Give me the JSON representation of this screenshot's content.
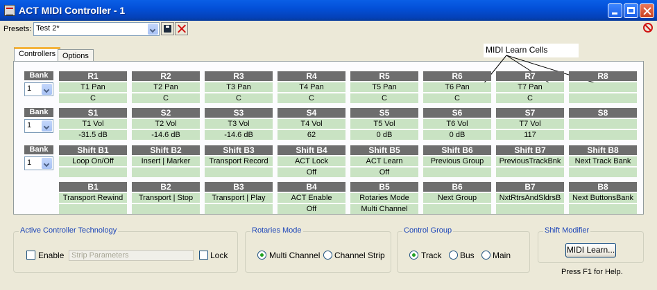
{
  "window": {
    "title": "ACT MIDI Controller - 1"
  },
  "presets": {
    "label": "Presets:",
    "value": "Test 2*"
  },
  "tabs": [
    {
      "label": "Controllers"
    },
    {
      "label": "Options"
    }
  ],
  "annotation": "MIDI Learn Cells",
  "bank_label": "Bank",
  "rows": [
    {
      "bank": "1",
      "cells": [
        {
          "h": "R1",
          "a": "T1 Pan",
          "b": "C"
        },
        {
          "h": "R2",
          "a": "T2 Pan",
          "b": "C"
        },
        {
          "h": "R3",
          "a": "T3 Pan",
          "b": "C"
        },
        {
          "h": "R4",
          "a": "T4 Pan",
          "b": "C"
        },
        {
          "h": "R5",
          "a": "T5 Pan",
          "b": "C"
        },
        {
          "h": "R6",
          "a": "T6 Pan",
          "b": "C"
        },
        {
          "h": "R7",
          "a": "T7 Pan",
          "b": "C"
        },
        {
          "h": "R8",
          "a": "",
          "b": ""
        }
      ]
    },
    {
      "bank": "1",
      "cells": [
        {
          "h": "S1",
          "a": "T1 Vol",
          "b": "-31.5  dB"
        },
        {
          "h": "S2",
          "a": "T2 Vol",
          "b": "-14.6  dB"
        },
        {
          "h": "S3",
          "a": "T3 Vol",
          "b": "-14.6  dB"
        },
        {
          "h": "S4",
          "a": "T4 Vol",
          "b": "62"
        },
        {
          "h": "S5",
          "a": "T5 Vol",
          "b": "0  dB"
        },
        {
          "h": "S6",
          "a": "T6 Vol",
          "b": "0  dB"
        },
        {
          "h": "S7",
          "a": "T7 Vol",
          "b": "117"
        },
        {
          "h": "S8",
          "a": "",
          "b": ""
        }
      ]
    },
    {
      "bank": "1",
      "cells": [
        {
          "h": "Shift B1",
          "a": "Loop On/Off",
          "b": ""
        },
        {
          "h": "Shift B2",
          "a": "Insert | Marker",
          "b": ""
        },
        {
          "h": "Shift B3",
          "a": "Transport Record",
          "b": ""
        },
        {
          "h": "Shift B4",
          "a": "ACT Lock",
          "b": "Off"
        },
        {
          "h": "Shift B5",
          "a": "ACT Learn",
          "b": "Off"
        },
        {
          "h": "Shift B6",
          "a": "Previous Group",
          "b": ""
        },
        {
          "h": "Shift B7",
          "a": "PreviousTrackBnk",
          "b": ""
        },
        {
          "h": "Shift B8",
          "a": "Next Track Bank",
          "b": ""
        }
      ]
    },
    {
      "bank": null,
      "cells": [
        {
          "h": "B1",
          "a": "Transport Rewind",
          "b": ""
        },
        {
          "h": "B2",
          "a": "Transport | Stop",
          "b": ""
        },
        {
          "h": "B3",
          "a": "Transport | Play",
          "b": ""
        },
        {
          "h": "B4",
          "a": "ACT Enable",
          "b": "Off"
        },
        {
          "h": "B5",
          "a": "Rotaries Mode",
          "b": "Multi Channel"
        },
        {
          "h": "B6",
          "a": "Next Group",
          "b": ""
        },
        {
          "h": "B7",
          "a": "NxtRtrsAndSldrsB",
          "b": ""
        },
        {
          "h": "B8",
          "a": "Next ButtonsBank",
          "b": ""
        }
      ]
    }
  ],
  "act_group": {
    "legend": "Active Controller Technology",
    "enable_label": "Enable",
    "field_value": "Strip Parameters",
    "lock_label": "Lock"
  },
  "rotaries_group": {
    "legend": "Rotaries Mode",
    "options": [
      "Multi Channel",
      "Channel Strip"
    ],
    "selected": "Multi Channel"
  },
  "control_group": {
    "legend": "Control Group",
    "options": [
      "Track",
      "Bus",
      "Main"
    ],
    "selected": "Track"
  },
  "shift_group": {
    "legend": "Shift Modifier",
    "button_label": "MIDI Learn..."
  },
  "help_text": "Press F1 for Help."
}
